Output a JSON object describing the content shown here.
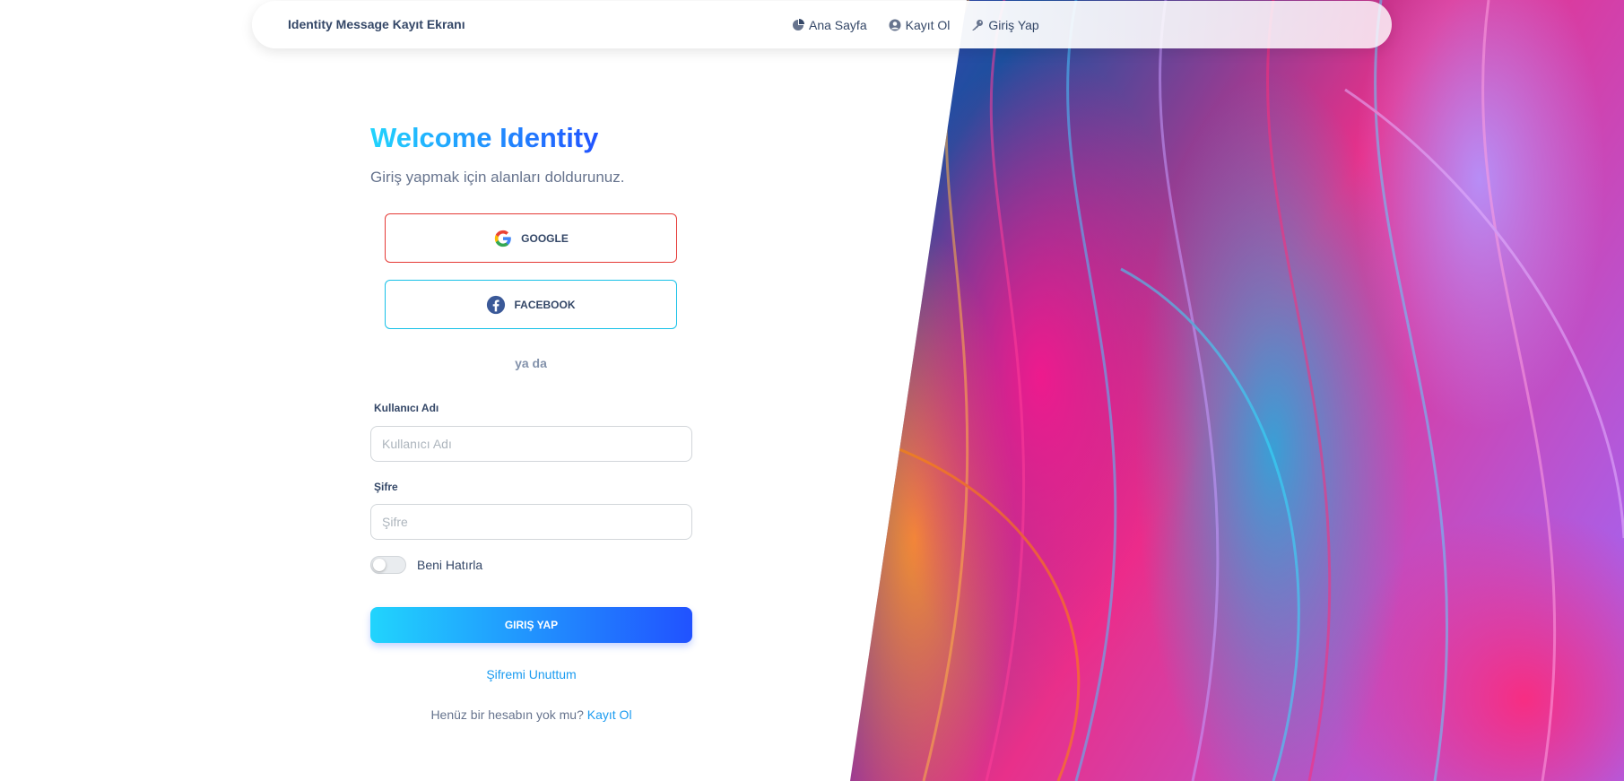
{
  "navbar": {
    "brand": "Identity Message Kayıt Ekranı",
    "links": [
      {
        "label": "Ana Sayfa",
        "icon": "pie-chart-icon"
      },
      {
        "label": "Kayıt Ol",
        "icon": "user-circle-icon"
      },
      {
        "label": "Giriş Yap",
        "icon": "key-icon"
      }
    ]
  },
  "login": {
    "title": "Welcome Identity",
    "subtitle": "Giriş yapmak için alanları doldurunuz.",
    "google_label": "GOOGLE",
    "facebook_label": "FACEBOOK",
    "or_text": "ya da",
    "username_label": "Kullanıcı Adı",
    "username_placeholder": "Kullanıcı Adı",
    "username_value": "",
    "password_label": "Şifre",
    "password_placeholder": "Şifre",
    "password_value": "",
    "remember_label": "Beni Hatırla",
    "remember_checked": false,
    "submit_label": "GIRIŞ YAP",
    "forgot_label": "Şifremi Unuttum",
    "signup_prompt": "Henüz bir hesabın yok mu?",
    "signup_link": "Kayıt Ol"
  },
  "colors": {
    "accent_start": "#21d4fd",
    "accent_end": "#2152ff",
    "google_border": "#e53935",
    "facebook_border": "#17c1e8",
    "text_dark": "#344767",
    "text_muted": "#67748e"
  }
}
